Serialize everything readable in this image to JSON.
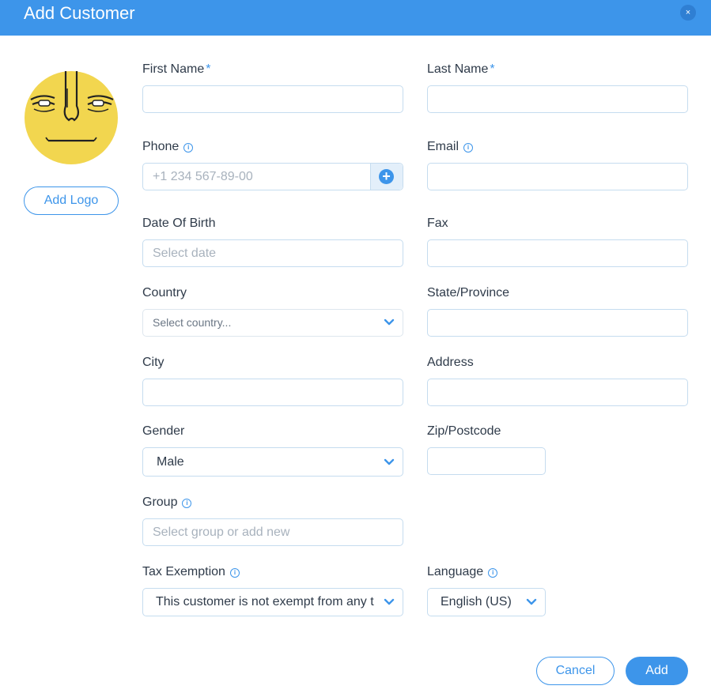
{
  "dialog": {
    "title": "Add Customer",
    "close_icon": "×",
    "add_logo_label": "Add Logo"
  },
  "fields": {
    "first_name": {
      "label": "First Name",
      "required": "*",
      "value": ""
    },
    "last_name": {
      "label": "Last Name",
      "required": "*",
      "value": ""
    },
    "phone": {
      "label": "Phone",
      "placeholder": "+1 234 567-89-00",
      "add_icon": "+"
    },
    "email": {
      "label": "Email",
      "value": ""
    },
    "date_of_birth": {
      "label": "Date Of Birth",
      "placeholder": "Select date"
    },
    "fax": {
      "label": "Fax",
      "value": ""
    },
    "country": {
      "label": "Country",
      "placeholder": "Select country..."
    },
    "state": {
      "label": "State/Province",
      "value": ""
    },
    "city": {
      "label": "City",
      "value": ""
    },
    "address": {
      "label": "Address",
      "value": ""
    },
    "gender": {
      "label": "Gender",
      "selected": "Male"
    },
    "zip": {
      "label": "Zip/Postcode",
      "value": ""
    },
    "group": {
      "label": "Group",
      "placeholder": "Select group or add new"
    },
    "tax_exemption": {
      "label": "Tax Exemption",
      "selected": "This customer is not exempt from any t"
    },
    "language": {
      "label": "Language",
      "selected": "English (US)"
    }
  },
  "info_icon": "i",
  "actions": {
    "cancel_label": "Cancel",
    "add_label": "Add"
  },
  "colors": {
    "accent": "#3d95ea",
    "avatar_face": "#f2d64f"
  }
}
